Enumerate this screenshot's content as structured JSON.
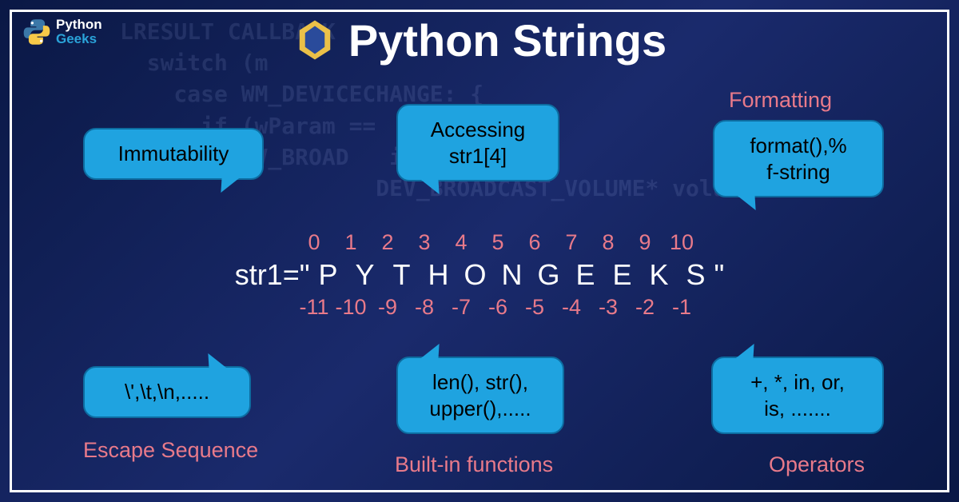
{
  "brand": {
    "line1": "Python",
    "line2": "Geeks"
  },
  "title": "Python Strings",
  "bg_code": "LRESULT CALLBACK\n  switch (m\n    case WM_DEVICECHANGE: {\n      if (wParam ==\n        DEV_BROAD   if (info-\n                   DEV_BROADCAST_VOLUME* volume",
  "bubbles": {
    "immut": "Immutability",
    "access_l1": "Accessing",
    "access_l2": "str1[4]",
    "format_l1": "format(),%",
    "format_l2": "f-string",
    "escape": "\\',\\t,\\n,.....",
    "builtin_l1": "len(), str(),",
    "builtin_l2": "upper(),.....",
    "ops_l1": "+, *, in, or,",
    "ops_l2": "is, ......."
  },
  "labels": {
    "formatting": "Formatting",
    "escape": "Escape Sequence",
    "builtin": "Built-in functions",
    "operators": "Operators"
  },
  "center": {
    "prefix": "str1=\"",
    "suffix": "\"",
    "chars": [
      "P",
      "Y",
      "T",
      "H",
      "O",
      "N",
      "G",
      "E",
      "E",
      "K",
      "S"
    ],
    "pos_idx": [
      "0",
      "1",
      "2",
      "3",
      "4",
      "5",
      "6",
      "7",
      "8",
      "9",
      "10"
    ],
    "neg_idx": [
      "-11",
      "-10",
      "-9",
      "-8",
      "-7",
      "-6",
      "-5",
      "-4",
      "-3",
      "-2",
      "-1"
    ]
  }
}
